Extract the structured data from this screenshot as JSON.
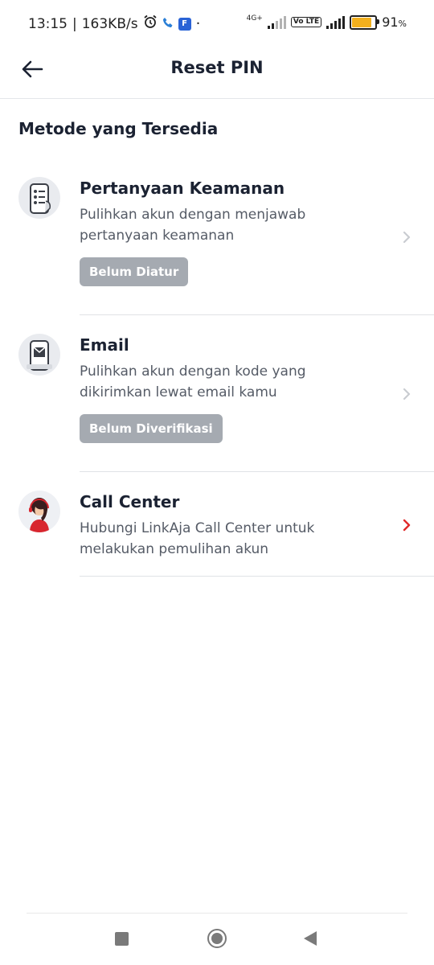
{
  "status_bar": {
    "time": "13:15",
    "net_speed": "163KB/s",
    "network_type": "4G+",
    "volte": "Vo LTE",
    "battery_percent": "91",
    "battery_symbol": "%",
    "battery_level": 0.91,
    "battery_color": "#f2b01e"
  },
  "header": {
    "title": "Reset PIN"
  },
  "section_title": "Metode yang Tersedia",
  "methods": [
    {
      "title": "Pertanyaan Keamanan",
      "desc_line1": "Pulihkan akun dengan menjawab",
      "desc_line2": "pertanyaan keamanan",
      "badge": "Belum Diatur",
      "icon": "security-question-phone-icon"
    },
    {
      "title": "Email",
      "desc_line1": "Pulihkan akun dengan kode yang",
      "desc_line2": "dikirimkan lewat email kamu",
      "badge": "Belum Diverifikasi",
      "icon": "email-phone-icon"
    },
    {
      "title": "Call Center",
      "desc_line1": "Hubungi LinkAja Call Center untuk",
      "desc_line2": "melakukan pemulihan akun",
      "badge": "",
      "icon": "call-center-agent-icon"
    }
  ],
  "colors": {
    "chevron_disabled": "#c9ccd1",
    "chevron_active": "#e02a2a",
    "badge_bg": "#a5aab1"
  }
}
